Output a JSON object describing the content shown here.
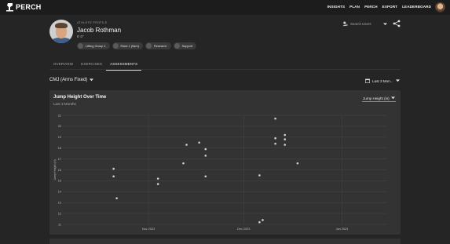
{
  "app": {
    "brand": "PERCH"
  },
  "nav": {
    "items": [
      "INSIGHTS",
      "PLAN",
      "PERCH",
      "EXPORT",
      "LEADERBOARD"
    ]
  },
  "profile": {
    "role": "ATHLETE PROFILE",
    "name": "Jacob Rothman",
    "height": "6' 0\"",
    "chips": [
      "Lifting Group 1",
      "Rack 1 (9am)",
      "Research",
      "Support"
    ]
  },
  "search": {
    "placeholder": "Search Users"
  },
  "tabs": [
    "OVERVIEW",
    "EXERCISES",
    "ASSESSMENTS"
  ],
  "active_tab": "ASSESSMENTS",
  "selectors": {
    "metric": "CMJ (Arms Fixed)",
    "range": "Last 3 Mon..."
  },
  "card": {
    "title": "Jump Height Over Time",
    "subtitle": "Last 3 Months",
    "unit_select": "Jump Height (in)"
  },
  "colors": {
    "accent": "#6a8ecb",
    "point": "#d0d0d0",
    "grid": "#464646"
  },
  "chart_data": {
    "type": "scatter",
    "title": "Jump Height Over Time",
    "subtitle": "Last 3 Months",
    "xlabel": "",
    "ylabel": "Jump Height (in)",
    "ylim": [
      11,
      21
    ],
    "yticks": [
      11,
      12,
      13,
      14,
      15,
      16,
      17,
      18,
      19,
      20,
      21
    ],
    "xlim": [
      "2023-10-05",
      "2024-01-15"
    ],
    "xticks": [
      {
        "value": "2023-11-01",
        "label": "Nov 2023"
      },
      {
        "value": "2023-12-01",
        "label": "Dec 2023"
      },
      {
        "value": "2024-01-01",
        "label": "Jan 2024"
      }
    ],
    "grid": true,
    "points": [
      {
        "x": "2023-10-21",
        "y": 16.1
      },
      {
        "x": "2023-10-21",
        "y": 15.4
      },
      {
        "x": "2023-10-22",
        "y": 13.4
      },
      {
        "x": "2023-11-04",
        "y": 15.2
      },
      {
        "x": "2023-11-04",
        "y": 14.7
      },
      {
        "x": "2023-11-12",
        "y": 16.6
      },
      {
        "x": "2023-11-13",
        "y": 18.3
      },
      {
        "x": "2023-11-17",
        "y": 18.5
      },
      {
        "x": "2023-11-19",
        "y": 17.9
      },
      {
        "x": "2023-11-19",
        "y": 17.3
      },
      {
        "x": "2023-11-19",
        "y": 15.4
      },
      {
        "x": "2023-12-06",
        "y": 15.5
      },
      {
        "x": "2023-12-06",
        "y": 11.2
      },
      {
        "x": "2023-12-07",
        "y": 11.4
      },
      {
        "x": "2023-12-11",
        "y": 20.7
      },
      {
        "x": "2023-12-11",
        "y": 18.9
      },
      {
        "x": "2023-12-11",
        "y": 18.4
      },
      {
        "x": "2023-12-14",
        "y": 19.2
      },
      {
        "x": "2023-12-14",
        "y": 18.8
      },
      {
        "x": "2023-12-14",
        "y": 18.3
      },
      {
        "x": "2023-12-18",
        "y": 16.6
      }
    ]
  }
}
